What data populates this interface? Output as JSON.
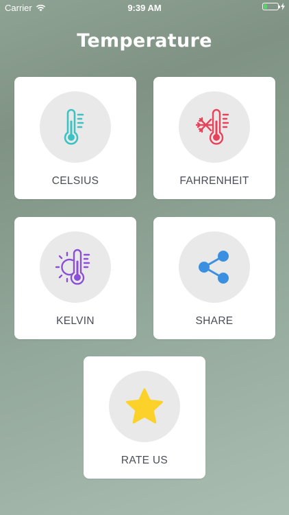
{
  "status_bar": {
    "carrier": "Carrier",
    "time": "9:39 AM",
    "battery_level": 0.25
  },
  "title": "Temperature",
  "cards": {
    "celsius": {
      "label": "CELSIUS",
      "icon": "thermometer-icon",
      "color": "#3cc2c2"
    },
    "fahrenheit": {
      "label": "FAHRENHEIT",
      "icon": "snowflake-thermometer-icon",
      "color": "#e8415a"
    },
    "kelvin": {
      "label": "KELVIN",
      "icon": "sun-thermometer-icon",
      "color": "#8a4fd6"
    },
    "share": {
      "label": "SHARE",
      "icon": "share-icon",
      "color": "#3b8fe0"
    },
    "rate": {
      "label": "RATE US",
      "icon": "star-icon",
      "color": "#fcd12a"
    }
  }
}
